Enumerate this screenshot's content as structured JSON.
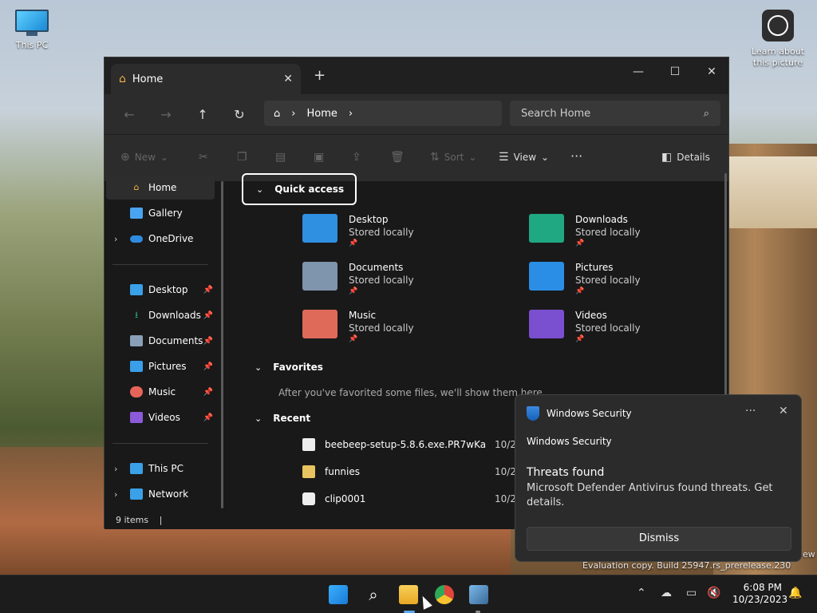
{
  "desktop": {
    "icons": [
      {
        "label": "This PC"
      },
      {
        "label": "Learn about this picture"
      }
    ]
  },
  "explorer": {
    "tab_title": "Home",
    "new_tab": "+",
    "window_controls": {
      "minimize": "—",
      "maximize": "☐",
      "close": "✕"
    },
    "nav": {
      "back": "←",
      "forward": "→",
      "up": "↑",
      "refresh": "↻"
    },
    "breadcrumb": [
      "Home"
    ],
    "search_placeholder": "Search Home",
    "toolbar": {
      "new": "New",
      "sort": "Sort",
      "view": "View",
      "more": "···",
      "details": "Details"
    },
    "sidebar": {
      "top": [
        {
          "label": "Home",
          "icon": "home-icon",
          "color": "#f4b041"
        },
        {
          "label": "Gallery",
          "icon": "gallery-icon",
          "color": "#4aa3f0"
        },
        {
          "label": "OneDrive",
          "icon": "onedrive-icon",
          "color": "#2f8be0"
        }
      ],
      "pinned": [
        {
          "label": "Desktop",
          "icon": "desktop-folder-icon",
          "color": "#3aa0e8"
        },
        {
          "label": "Downloads",
          "icon": "downloads-folder-icon",
          "color": "#2fb57a"
        },
        {
          "label": "Documents",
          "icon": "documents-folder-icon",
          "color": "#8aa0b8"
        },
        {
          "label": "Pictures",
          "icon": "pictures-folder-icon",
          "color": "#3a9ee8"
        },
        {
          "label": "Music",
          "icon": "music-folder-icon",
          "color": "#e8645a"
        },
        {
          "label": "Videos",
          "icon": "videos-folder-icon",
          "color": "#8a5ad8"
        }
      ],
      "bottom": [
        {
          "label": "This PC",
          "icon": "this-pc-icon",
          "color": "#3aa0e8"
        },
        {
          "label": "Network",
          "icon": "network-icon",
          "color": "#3aa0e8"
        }
      ]
    },
    "quick_access": {
      "title": "Quick access",
      "items": [
        {
          "name": "Desktop",
          "status": "Stored locally",
          "color": "#2f8fe0"
        },
        {
          "name": "Downloads",
          "status": "Stored locally",
          "color": "#1fa881"
        },
        {
          "name": "Documents",
          "status": "Stored locally",
          "color": "#7f94ad"
        },
        {
          "name": "Pictures",
          "status": "Stored locally",
          "color": "#2a8ee6"
        },
        {
          "name": "Music",
          "status": "Stored locally",
          "color": "#e06a5a"
        },
        {
          "name": "Videos",
          "status": "Stored locally",
          "color": "#7a4fd0"
        }
      ]
    },
    "favorites": {
      "title": "Favorites",
      "empty_note": "After you've favorited some files, we'll show them here."
    },
    "recent": {
      "title": "Recent",
      "items": [
        {
          "name": "beebeep-setup-5.8.6.exe.PR7wKa",
          "date": "10/23"
        },
        {
          "name": "funnies",
          "date": "10/23"
        },
        {
          "name": "clip0001",
          "date": "10/23"
        }
      ]
    },
    "status": "9 items"
  },
  "toast": {
    "app": "Windows Security",
    "sender": "Windows Security",
    "title": "Threats found",
    "body": "Microsoft Defender Antivirus found threats. Get details.",
    "button": "Dismiss"
  },
  "watermark": "Evaluation copy. Build 25947.rs_prerelease.230",
  "watermark_tail": "ew",
  "taskbar": {
    "time": "6:08 PM",
    "date": "10/23/2023"
  }
}
